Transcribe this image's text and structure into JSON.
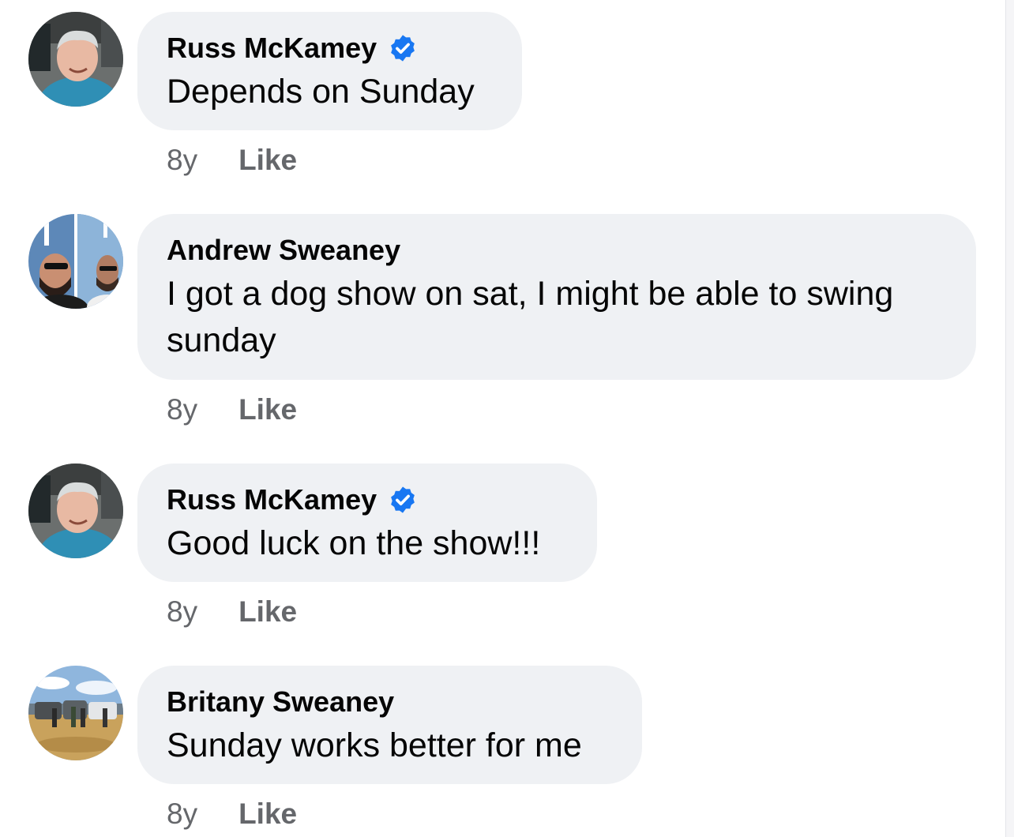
{
  "comments": [
    {
      "author": "Russ McKamey",
      "verified": true,
      "text": "Depends on Sunday",
      "time": "8y",
      "like_label": "Like"
    },
    {
      "author": "Andrew Sweaney",
      "verified": false,
      "text": "I got a dog show on sat, I might be able to swing sunday",
      "time": "8y",
      "like_label": "Like"
    },
    {
      "author": "Russ McKamey",
      "verified": true,
      "text": "Good luck on the show!!!",
      "time": "8y",
      "like_label": "Like"
    },
    {
      "author": "Britany Sweaney",
      "verified": false,
      "text": "Sunday works better for me",
      "time": "8y",
      "like_label": "Like"
    }
  ],
  "colors": {
    "bubble": "#eff1f4",
    "verified_badge": "#1877f2",
    "meta_text": "#65676b"
  }
}
